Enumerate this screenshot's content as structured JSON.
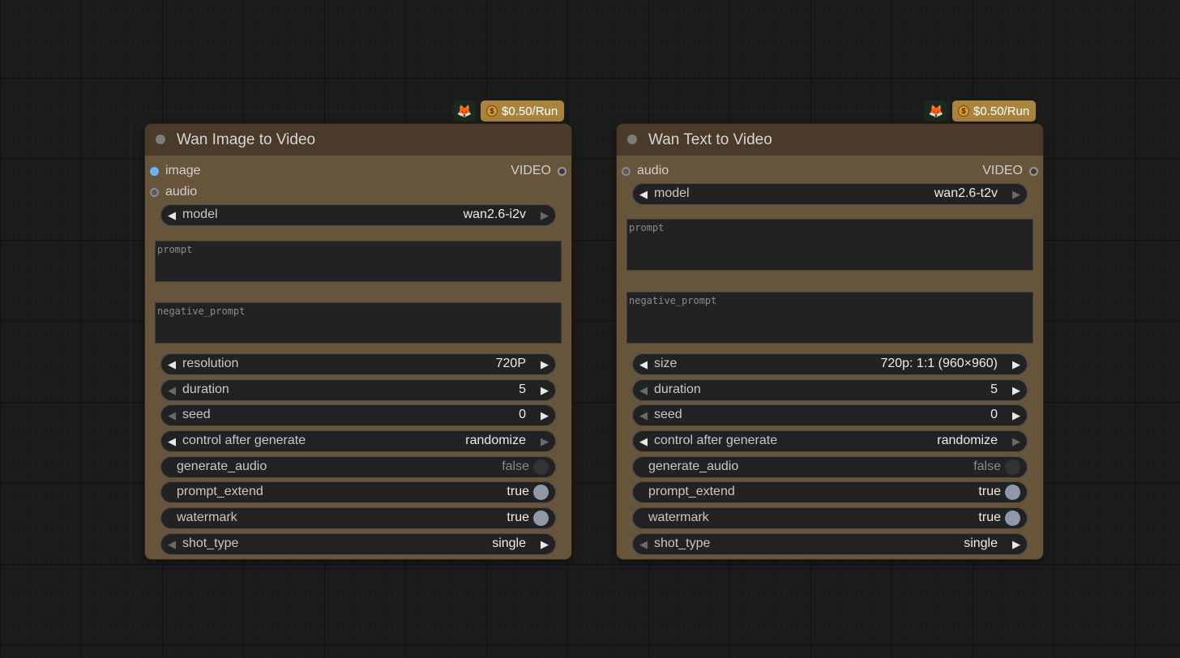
{
  "nodes": [
    {
      "title": "Wan Image to Video",
      "price_label": "$0.50/Run",
      "coin_symbol": "$",
      "partner_icon": "🦊",
      "inputs": [
        {
          "label": "image",
          "type": "image"
        },
        {
          "label": "audio",
          "type": "audio"
        }
      ],
      "output": "VIDEO",
      "model": {
        "label": "model",
        "value": "wan2.6-i2v"
      },
      "prompt_placeholder": "prompt",
      "negative_prompt_placeholder": "negative_prompt",
      "widgets": [
        {
          "kind": "combo",
          "label": "resolution",
          "value": "720P"
        },
        {
          "kind": "combo",
          "label": "duration",
          "value": "5"
        },
        {
          "kind": "combo",
          "label": "seed",
          "value": "0"
        },
        {
          "kind": "combo",
          "label": "control after generate",
          "value": "randomize"
        },
        {
          "kind": "toggle",
          "label": "generate_audio",
          "value": "false",
          "on": false
        },
        {
          "kind": "toggle",
          "label": "prompt_extend",
          "value": "true",
          "on": true
        },
        {
          "kind": "toggle",
          "label": "watermark",
          "value": "true",
          "on": true
        },
        {
          "kind": "combo",
          "label": "shot_type",
          "value": "single"
        }
      ]
    },
    {
      "title": "Wan Text to Video",
      "price_label": "$0.50/Run",
      "coin_symbol": "$",
      "partner_icon": "🦊",
      "inputs": [
        {
          "label": "audio",
          "type": "audio"
        }
      ],
      "output": "VIDEO",
      "model": {
        "label": "model",
        "value": "wan2.6-t2v"
      },
      "prompt_placeholder": "prompt",
      "negative_prompt_placeholder": "negative_prompt",
      "widgets": [
        {
          "kind": "combo",
          "label": "size",
          "value": "720p: 1:1 (960×960)"
        },
        {
          "kind": "combo",
          "label": "duration",
          "value": "5"
        },
        {
          "kind": "combo",
          "label": "seed",
          "value": "0"
        },
        {
          "kind": "combo",
          "label": "control after generate",
          "value": "randomize"
        },
        {
          "kind": "toggle",
          "label": "generate_audio",
          "value": "false",
          "on": false
        },
        {
          "kind": "toggle",
          "label": "prompt_extend",
          "value": "true",
          "on": true
        },
        {
          "kind": "toggle",
          "label": "watermark",
          "value": "true",
          "on": true
        },
        {
          "kind": "combo",
          "label": "shot_type",
          "value": "single"
        }
      ]
    }
  ]
}
